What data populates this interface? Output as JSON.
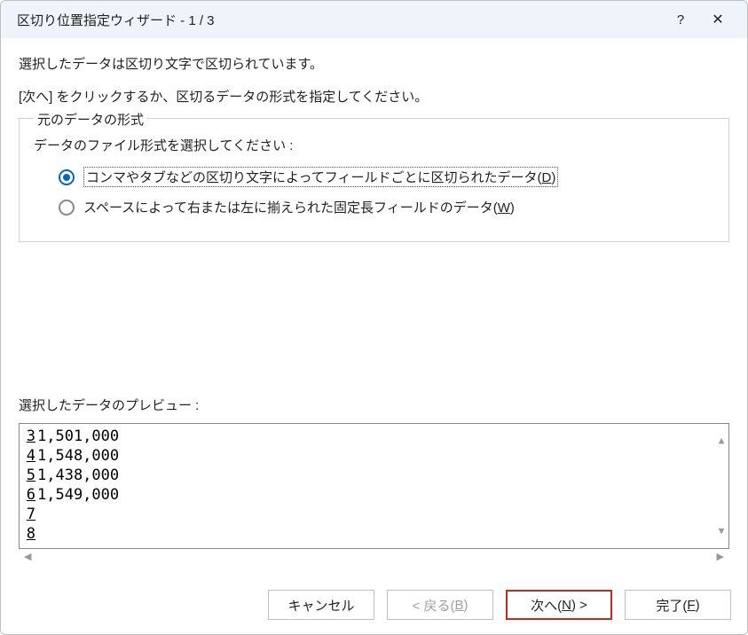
{
  "titlebar": {
    "title": "区切り位置指定ウィザード - 1 / 3",
    "help": "?",
    "close": "✕"
  },
  "intro": {
    "line1": "選択したデータは区切り文字で区切られています。",
    "line2": "[次へ] をクリックするか、区切るデータの形式を指定してください。"
  },
  "fieldset": {
    "legend": "元のデータの形式",
    "prompt": "データのファイル形式を選択してください :",
    "options": [
      {
        "pre": "コンマやタブなどの区切り文字によってフィールドごとに区切られたデータ(",
        "accel": "D",
        "post": ")",
        "selected": true,
        "focused": true
      },
      {
        "pre": "スペースによって右または左に揃えられた固定長フィールドのデータ(",
        "accel": "W",
        "post": ")",
        "selected": false,
        "focused": false
      }
    ]
  },
  "preview": {
    "label": "選択したデータのプレビュー :",
    "rows": [
      {
        "n": "3",
        "v": "1,501,000"
      },
      {
        "n": "4",
        "v": "1,548,000"
      },
      {
        "n": "5",
        "v": "1,438,000"
      },
      {
        "n": "6",
        "v": "1,549,000"
      },
      {
        "n": "7",
        "v": ""
      },
      {
        "n": "8",
        "v": ""
      }
    ]
  },
  "buttons": {
    "cancel": "キャンセル",
    "back_pre": "< 戻る(",
    "back_accel": "B",
    "back_post": ")",
    "next_pre": "次へ(",
    "next_accel": "N",
    "next_post": ") >",
    "finish_pre": "完了(",
    "finish_accel": "F",
    "finish_post": ")"
  }
}
